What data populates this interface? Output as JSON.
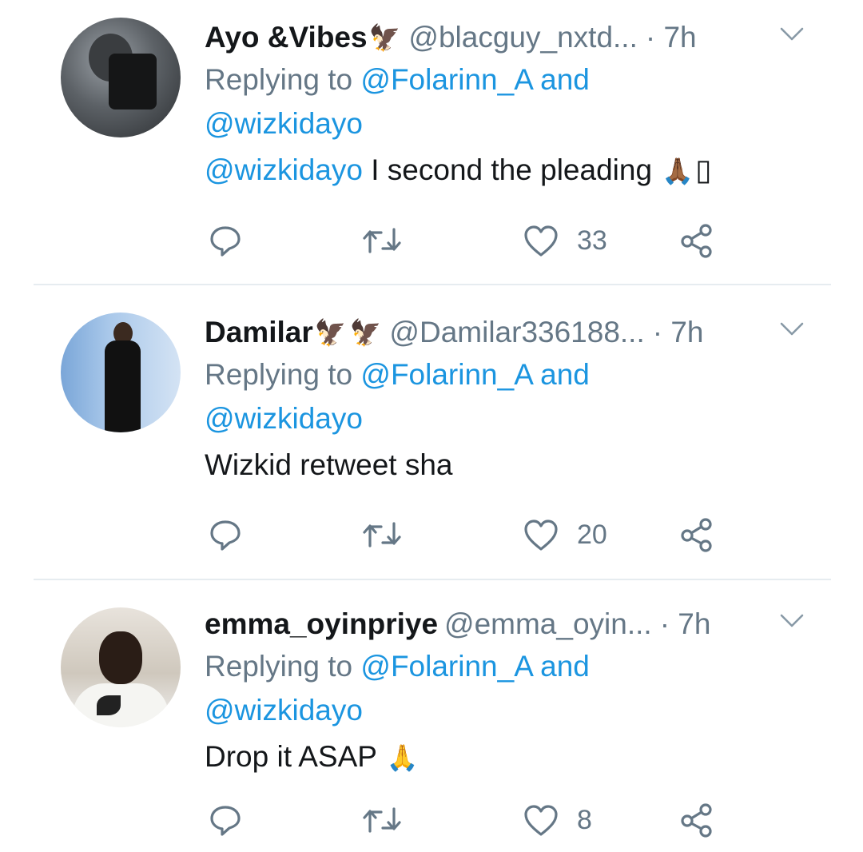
{
  "colors": {
    "link": "#1b95e0",
    "secondary": "#657786",
    "text": "#14171a",
    "divider": "#e6ecf0"
  },
  "replying_prefix": "Replying to",
  "tweets": [
    {
      "display_name": "Ayo &Vibes",
      "name_emojis": [
        "🦅"
      ],
      "handle": "@blacguy_nxtd...",
      "time": "· 7h",
      "reply_mention_1": "@Folarinn_A",
      "reply_and": "and",
      "reply_mention_2": "@wizkidayo",
      "body_mention": "@wizkidayo",
      "body_text": " I second the pleading ",
      "body_emoji": "🙏🏾",
      "body_emoji_extra": "▯",
      "like_count": "33",
      "icons": [
        "reply-icon",
        "retweet-icon",
        "heart-icon",
        "share-icon"
      ]
    },
    {
      "display_name": "Damilar",
      "name_emojis": [
        "🦅",
        "🦅"
      ],
      "handle": "@Damilar336188...",
      "time": "· 7h",
      "reply_mention_1": "@Folarinn_A",
      "reply_and": "and",
      "reply_mention_2": "@wizkidayo",
      "body_text": "Wizkid retweet sha",
      "like_count": "20",
      "icons": [
        "reply-icon",
        "retweet-icon",
        "heart-icon",
        "share-icon"
      ]
    },
    {
      "display_name": "emma_oyinpriye",
      "handle": "@emma_oyin...",
      "time": "· 7h",
      "reply_mention_1": "@Folarinn_A",
      "reply_and": "and",
      "reply_mention_2": "@wizkidayo",
      "body_text": "Drop it ASAP ",
      "body_emoji": "🙏",
      "like_count": "8",
      "icons": [
        "reply-icon",
        "retweet-icon",
        "heart-icon",
        "share-icon"
      ]
    }
  ]
}
